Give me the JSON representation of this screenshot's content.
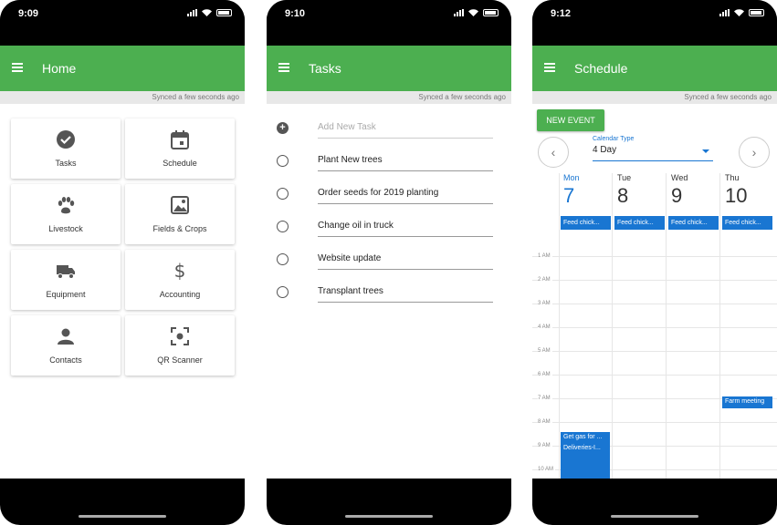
{
  "phones": [
    {
      "status_time": "9:09",
      "title": "Home",
      "sync_text": "Synced a few seconds ago",
      "tiles": [
        {
          "label": "Tasks",
          "icon": "check-circle-icon"
        },
        {
          "label": "Schedule",
          "icon": "calendar-icon"
        },
        {
          "label": "Livestock",
          "icon": "paw-icon"
        },
        {
          "label": "Fields & Crops",
          "icon": "image-icon"
        },
        {
          "label": "Equipment",
          "icon": "truck-icon"
        },
        {
          "label": "Accounting",
          "icon": "dollar-icon"
        },
        {
          "label": "Contacts",
          "icon": "person-icon"
        },
        {
          "label": "QR Scanner",
          "icon": "qr-scan-icon"
        }
      ]
    },
    {
      "status_time": "9:10",
      "title": "Tasks",
      "sync_text": "Synced a few seconds ago",
      "add_placeholder": "Add New Task",
      "tasks": [
        "Plant New trees",
        "Order seeds for 2019 planting",
        "Change oil in truck",
        "Website update",
        "Transplant trees"
      ]
    },
    {
      "status_time": "9:12",
      "title": "Schedule",
      "sync_text": "Synced a few seconds ago",
      "new_event_label": "NEW EVENT",
      "calendar_type_label": "Calendar Type",
      "calendar_type_value": "4 Day",
      "prev_icon": "chevron-left-icon",
      "next_icon": "chevron-right-icon",
      "days": [
        {
          "name": "Mon",
          "date": "7",
          "today": true,
          "allday": "Feed chick..."
        },
        {
          "name": "Tue",
          "date": "8",
          "today": false,
          "allday": "Feed chick..."
        },
        {
          "name": "Wed",
          "date": "9",
          "today": false,
          "allday": "Feed chick..."
        },
        {
          "name": "Thu",
          "date": "10",
          "today": false,
          "allday": "Feed chick..."
        }
      ],
      "hours": [
        "1 AM",
        "2 AM",
        "3 AM",
        "4 AM",
        "5 AM",
        "6 AM",
        "7 AM",
        "8 AM",
        "9 AM",
        "10 AM"
      ],
      "events": {
        "farm_meeting": "Farm meeting",
        "gas": "Get gas for ...",
        "deliveries": "Deliveries-I..."
      }
    }
  ],
  "colors": {
    "appbar": "#4caf50",
    "accent": "#1976d2"
  }
}
